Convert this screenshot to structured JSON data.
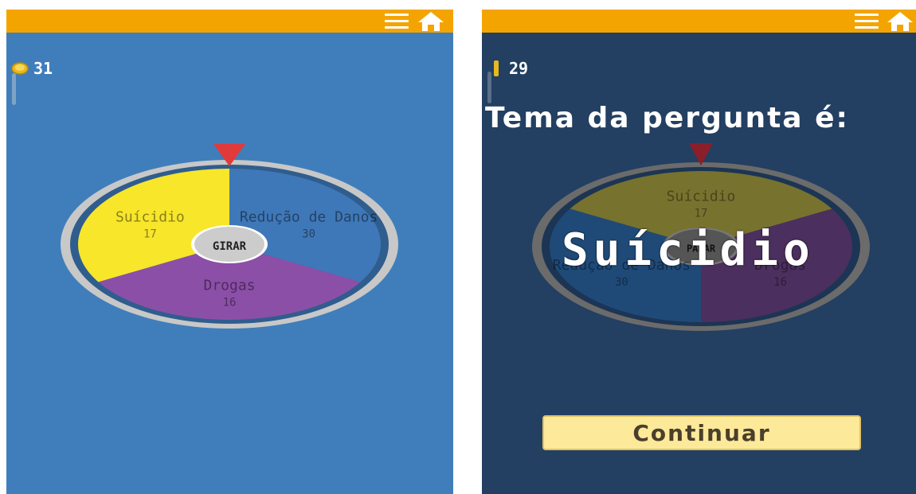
{
  "left_screen": {
    "coins": "31",
    "coin_icon": "coin-icon",
    "menu_icon": "hamburger-menu-icon",
    "home_icon": "home-icon",
    "spin_button_label": "GIRAR",
    "wheel": {
      "segments": [
        {
          "name": "Suícidio",
          "count": "17",
          "color": "#f7e62a"
        },
        {
          "name": "Redução de Danos",
          "count": "30",
          "color": "#3f78b8"
        },
        {
          "name": "Drogas",
          "count": "16",
          "color": "#8c4fa8"
        }
      ],
      "pointer_color": "#e13a3a"
    }
  },
  "right_screen": {
    "coins": "29",
    "title": "Tema da pergunta é:",
    "result": "Suícidio",
    "center_label": "PARAR",
    "continue_label": "Continuar",
    "wheel": {
      "segments": [
        {
          "name": "Suícidio",
          "count": "17",
          "color": "#77722e"
        },
        {
          "name": "Drogas",
          "count": "16",
          "color": "#4b2f5e"
        },
        {
          "name": "Redução de Danos",
          "count": "30",
          "color": "#1f4a78"
        }
      ],
      "pointer_color": "#8a1f2a"
    }
  },
  "colors": {
    "topbar": "#f4a400",
    "left_background": "#3f7ebb",
    "right_background": "#233f62",
    "button": "#fde99a"
  }
}
